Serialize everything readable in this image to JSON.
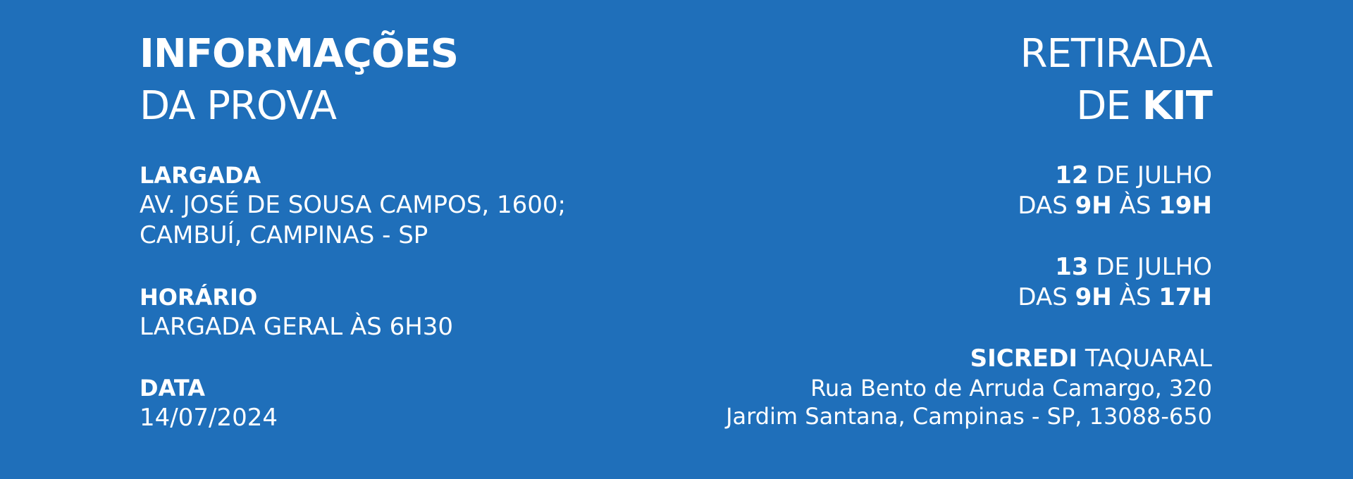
{
  "left": {
    "title_bold": "INFORMAÇÕES",
    "title_light": "DA PROVA",
    "largada": {
      "label": "LARGADA",
      "line1": "AV. JOSÉ DE SOUSA CAMPOS, 1600;",
      "line2": "CAMBUÍ, CAMPINAS - SP"
    },
    "horario": {
      "label": "HORÁRIO",
      "value": "LARGADA GERAL ÀS 6H30"
    },
    "data": {
      "label": "DATA",
      "value": "14/07/2024"
    }
  },
  "right": {
    "title_line1": "RETIRADA",
    "title_de": "DE",
    "title_kit": "KIT",
    "day1": {
      "day": "12",
      "month": "DE JULHO",
      "das": "DAS",
      "start": "9H",
      "as": "ÀS",
      "end": "19H"
    },
    "day2": {
      "day": "13",
      "month": "DE JULHO",
      "das": "DAS",
      "start": "9H",
      "as": "ÀS",
      "end": "17H"
    },
    "location": {
      "name_bold": "SICREDI",
      "name_light": "TAQUARAL",
      "street": "Rua Bento de Arruda Camargo, 320",
      "city": "Jardim Santana, Campinas - SP, 13088-650"
    }
  },
  "colors": {
    "background": "#1f6fba",
    "text": "#ffffff"
  }
}
